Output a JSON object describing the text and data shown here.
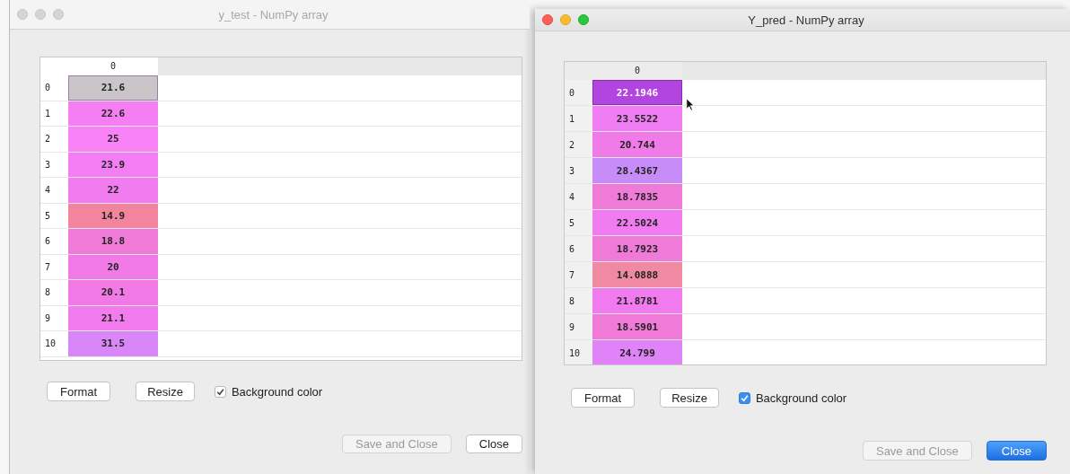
{
  "windows": [
    {
      "title": "y_test - NumPy array",
      "active": false,
      "column_header": "0",
      "rows": [
        {
          "index": "0",
          "value": "21.6",
          "color": "#c9c5c9",
          "selected": true
        },
        {
          "index": "1",
          "value": "22.6",
          "color": "#f47ef2",
          "selected": false
        },
        {
          "index": "2",
          "value": "25",
          "color": "#f982f9",
          "selected": false
        },
        {
          "index": "3",
          "value": "23.9",
          "color": "#f37ef3",
          "selected": false
        },
        {
          "index": "4",
          "value": "22",
          "color": "#f17cef",
          "selected": false
        },
        {
          "index": "5",
          "value": "14.9",
          "color": "#f2849e",
          "selected": false
        },
        {
          "index": "6",
          "value": "18.8",
          "color": "#f07ad8",
          "selected": false
        },
        {
          "index": "7",
          "value": "20",
          "color": "#f27ae6",
          "selected": false
        },
        {
          "index": "8",
          "value": "20.1",
          "color": "#f27ae6",
          "selected": false
        },
        {
          "index": "9",
          "value": "21.1",
          "color": "#f27cee",
          "selected": false
        },
        {
          "index": "10",
          "value": "31.5",
          "color": "#d986f8",
          "selected": false
        }
      ],
      "buttons": [
        "Format",
        "Resize"
      ],
      "checkbox": {
        "label": "Background color",
        "checked": true
      },
      "footer_buttons": [
        {
          "label": "Save and Close",
          "disabled": true,
          "default": false
        },
        {
          "label": "Close",
          "disabled": false,
          "default": false
        }
      ]
    },
    {
      "title": "Y_pred - NumPy array",
      "active": true,
      "column_header": "0",
      "rows": [
        {
          "index": "0",
          "value": "22.1946",
          "color": "#b244e0",
          "selected": true
        },
        {
          "index": "1",
          "value": "23.5522",
          "color": "#f07df4",
          "selected": false
        },
        {
          "index": "2",
          "value": "20.744",
          "color": "#f07ae8",
          "selected": false
        },
        {
          "index": "3",
          "value": "28.4367",
          "color": "#c88cf8",
          "selected": false
        },
        {
          "index": "4",
          "value": "18.7835",
          "color": "#f07ad8",
          "selected": false
        },
        {
          "index": "5",
          "value": "22.5024",
          "color": "#f07cf0",
          "selected": false
        },
        {
          "index": "6",
          "value": "18.7923",
          "color": "#f07ad8",
          "selected": false
        },
        {
          "index": "7",
          "value": "14.0888",
          "color": "#f08aa2",
          "selected": false
        },
        {
          "index": "8",
          "value": "21.8781",
          "color": "#f07aee",
          "selected": false
        },
        {
          "index": "9",
          "value": "18.5901",
          "color": "#f07ad8",
          "selected": false
        },
        {
          "index": "10",
          "value": "24.799",
          "color": "#e082f8",
          "selected": false
        }
      ],
      "buttons": [
        "Format",
        "Resize"
      ],
      "checkbox": {
        "label": "Background color",
        "checked": true
      },
      "footer_buttons": [
        {
          "label": "Save and Close",
          "disabled": true,
          "default": false
        },
        {
          "label": "Close",
          "disabled": false,
          "default": true
        }
      ]
    }
  ]
}
